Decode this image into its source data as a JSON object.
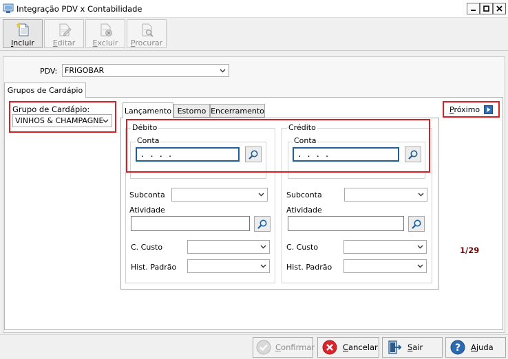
{
  "window": {
    "title": "Integração PDV x Contabilidade"
  },
  "toolbar": {
    "incluir": {
      "underline": "I",
      "rest": "ncluir"
    },
    "editar": {
      "underline": "E",
      "rest": "ditar"
    },
    "excluir": {
      "underline": "E",
      "rest": "xcluir"
    },
    "procurar": {
      "underline": "P",
      "rest": "rocurar"
    }
  },
  "pdv": {
    "label": "PDV:",
    "selected": "FRIGOBAR"
  },
  "outer_tab": {
    "label": "Grupos de Cardápio"
  },
  "grupo": {
    "label": "Grupo de Cardápio:",
    "selected": "VINHOS & CHAMPAGNES"
  },
  "inner_tabs": [
    {
      "label": "Lançamento"
    },
    {
      "label": "Estorno"
    },
    {
      "label": "Encerramento"
    }
  ],
  "debito": {
    "title": "Débito",
    "conta_label": "Conta",
    "conta_value": ". . . .",
    "subconta_label": "Subconta",
    "atividade_label": "Atividade",
    "ccusto_label": "C. Custo",
    "hist_label": "Hist. Padrão"
  },
  "credito": {
    "title": "Crédito",
    "conta_label": "Conta",
    "conta_value": ". . . .",
    "subconta_label": "Subconta",
    "atividade_label": "Atividade",
    "ccusto_label": "C. Custo",
    "hist_label": "Hist. Padrão"
  },
  "proximo": {
    "underline": "P",
    "rest": "róximo"
  },
  "counter": "1/29",
  "footer": {
    "confirmar": {
      "underline": "C",
      "rest": "onfirmar"
    },
    "cancelar": {
      "underline": "C",
      "rest": "ancelar"
    },
    "sair": {
      "underline": "S",
      "rest": "air"
    },
    "ajuda": {
      "underline": "A",
      "rest": "juda"
    }
  },
  "colors": {
    "highlight": "#d81f26",
    "focus_border": "#1f5f99",
    "counter": "#6e0a0a"
  }
}
